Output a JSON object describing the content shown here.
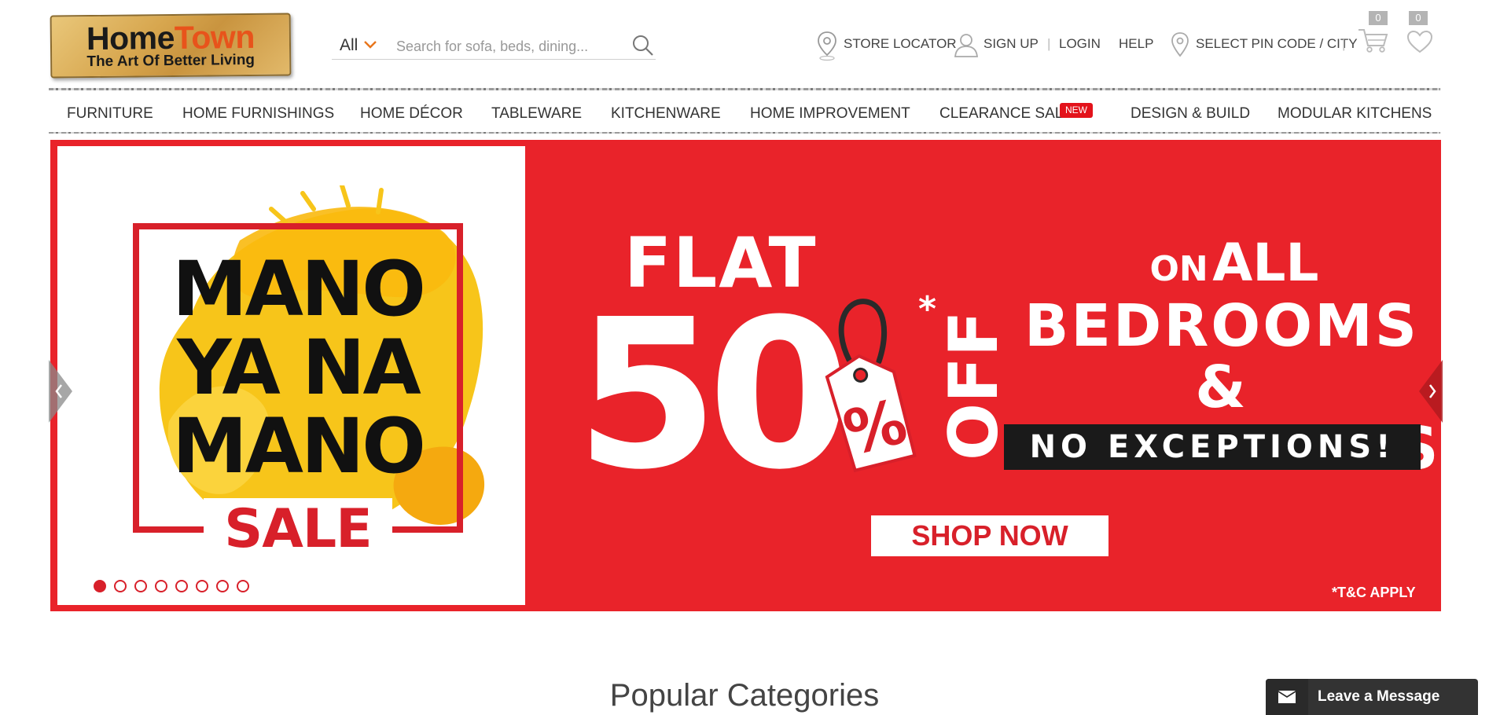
{
  "header": {
    "logo": {
      "brand_part1": "Home",
      "brand_part2": "Town",
      "tagline": "The Art Of Better Living"
    },
    "search": {
      "category": "All",
      "placeholder": "Search for sofa, beds, dining...",
      "value": ""
    },
    "links": {
      "store_locator": "STORE LOCATOR",
      "sign_up": "SIGN UP",
      "login": "LOGIN",
      "help": "HELP",
      "pincode": "SELECT PIN CODE / CITY"
    },
    "cart_count": "0",
    "wishlist_count": "0"
  },
  "nav": {
    "items": [
      "FURNITURE",
      "HOME FURNISHINGS",
      "HOME DÉCOR",
      "TABLEWARE",
      "KITCHENWARE",
      "HOME IMPROVEMENT",
      "CLEARANCE SALE",
      "DESIGN & BUILD",
      "MODULAR KITCHENS"
    ],
    "new_badge": "NEW"
  },
  "banner": {
    "left_lines": [
      "MANO",
      "YA NA",
      "MANO"
    ],
    "sale": "SALE",
    "flat": "FLAT",
    "fifty": "50",
    "percent": "%",
    "off": "OFF",
    "asterisk": "*",
    "on": "ON",
    "all": "ALL",
    "headline": "BEDROOMS &\nBATHROOMS",
    "no_exceptions": "NO EXCEPTIONS!",
    "cta": "SHOP NOW",
    "terms": "*T&C APPLY",
    "slides_total": 8,
    "active_slide": 1,
    "colors": {
      "banner_red": "#e9232a",
      "brand_red": "#d8202a",
      "yellow": "#f7c51a"
    }
  },
  "section_title": "Popular Categories",
  "chat": {
    "label": "Leave a Message"
  }
}
